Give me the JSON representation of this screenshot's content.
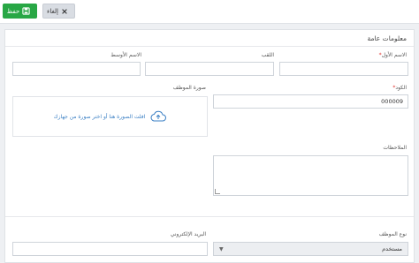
{
  "toolbar": {
    "save_label": "حفظ",
    "cancel_label": "إلغاء",
    "save_color": "#28a745"
  },
  "section": {
    "title": "معلومات عامة"
  },
  "fields": {
    "first_name": {
      "label": "الاسم الأول",
      "required": "*",
      "value": ""
    },
    "title": {
      "label": "اللقب",
      "value": ""
    },
    "middle_name": {
      "label": "الاسم الأوسط",
      "value": ""
    },
    "code": {
      "label": "الكود",
      "required": "*",
      "value": "000009"
    },
    "photo": {
      "label": "صورة الموظف",
      "upload_text": "افلت الصورة هنا أو اختر صورة من جهازك"
    },
    "notes": {
      "label": "الملاحظات",
      "value": ""
    },
    "employee_type": {
      "label": "نوع الموظف",
      "value": "مستخدم"
    },
    "email": {
      "label": "البريد الإلكتروني",
      "value": ""
    }
  }
}
